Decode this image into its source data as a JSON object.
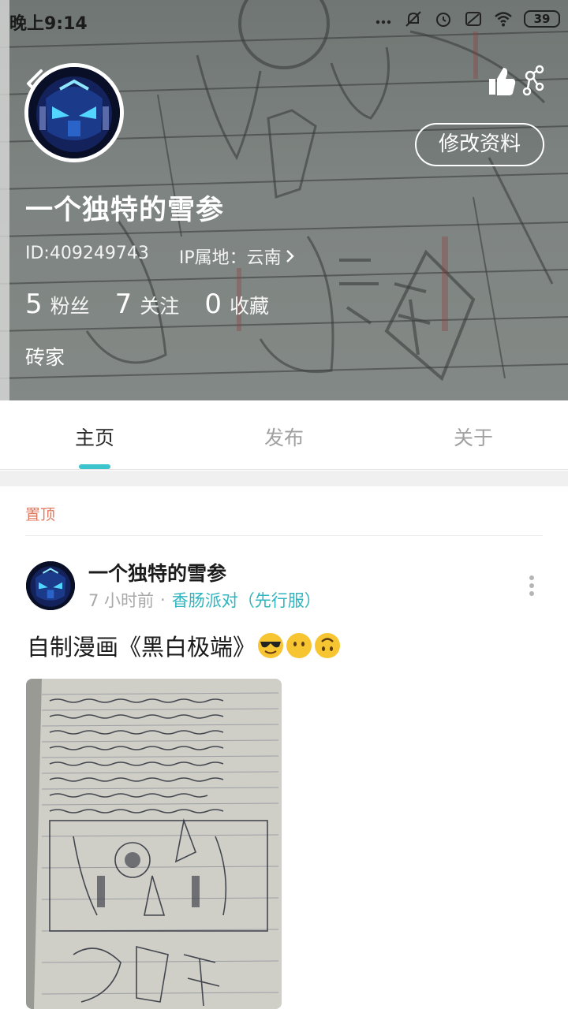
{
  "status_bar": {
    "time": "晚上9:14",
    "battery": "39"
  },
  "profile": {
    "username": "一个独特的雪参",
    "id_label": "ID:409249743",
    "ip_label": "IP属地：云南",
    "edit_button": "修改资料",
    "bio": "砖家",
    "stats": [
      {
        "value": "5",
        "label": "粉丝"
      },
      {
        "value": "7",
        "label": "关注"
      },
      {
        "value": "0",
        "label": "收藏"
      }
    ]
  },
  "tabs": [
    {
      "label": "主页",
      "active": true
    },
    {
      "label": "发布",
      "active": false
    },
    {
      "label": "关于",
      "active": false
    }
  ],
  "feed": {
    "pinned_label": "置顶",
    "post": {
      "author": "一个独特的雪参",
      "time": "7 小时前",
      "dot": "·",
      "source": "香肠派对（先行服）",
      "title": "自制漫画《黑白极端》",
      "emojis": [
        "smiling-face-with-sunglasses-icon",
        "face-without-mouth-icon",
        "upside-down-face-icon"
      ]
    }
  },
  "colors": {
    "accent": "#3cc4cc",
    "source_link": "#2fb5bf",
    "pinned": "#e07a5f"
  }
}
